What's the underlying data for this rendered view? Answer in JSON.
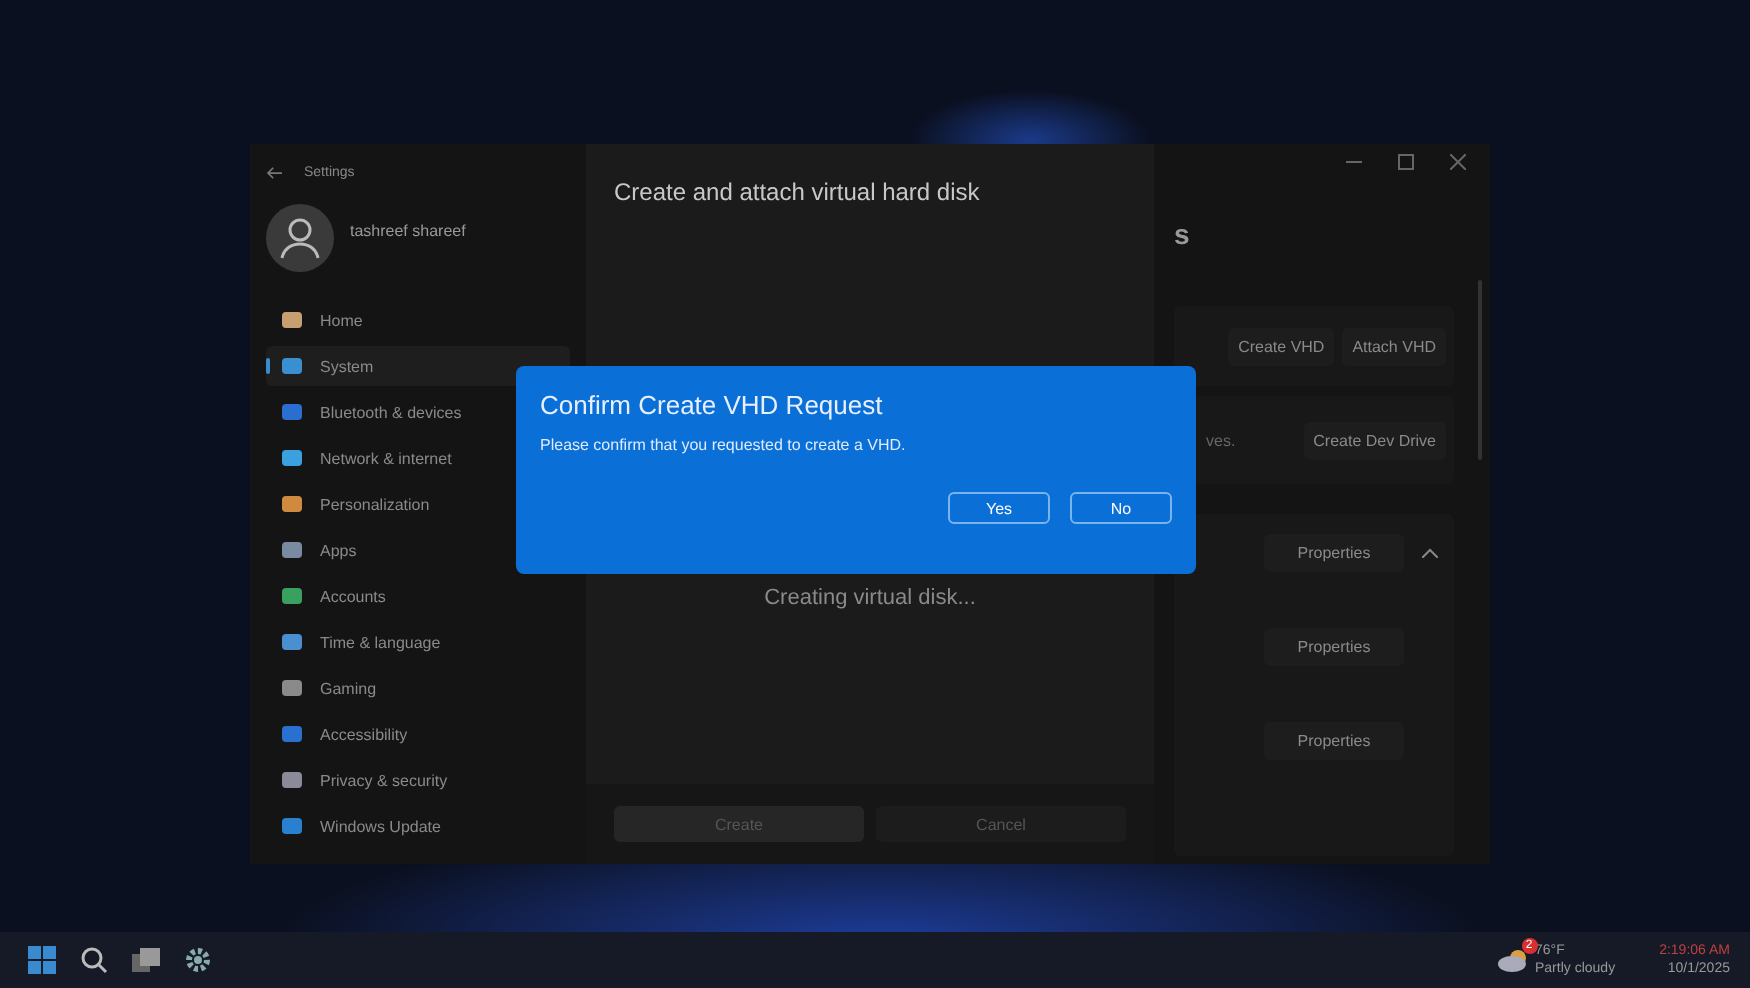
{
  "window": {
    "title": "Settings"
  },
  "user": {
    "name": "tashreef shareef"
  },
  "nav": [
    {
      "label": "Home",
      "selected": false
    },
    {
      "label": "System",
      "selected": true
    },
    {
      "label": "Bluetooth & devices",
      "selected": false
    },
    {
      "label": "Network & internet",
      "selected": false
    },
    {
      "label": "Personalization",
      "selected": false
    },
    {
      "label": "Apps",
      "selected": false
    },
    {
      "label": "Accounts",
      "selected": false
    },
    {
      "label": "Time & language",
      "selected": false
    },
    {
      "label": "Gaming",
      "selected": false
    },
    {
      "label": "Accessibility",
      "selected": false
    },
    {
      "label": "Privacy & security",
      "selected": false
    },
    {
      "label": "Windows Update",
      "selected": false
    }
  ],
  "page": {
    "title": "s",
    "actions": [
      "Create VHD",
      "Attach VHD"
    ],
    "dev_drive": {
      "text": "ves.",
      "button": "Create Dev Drive"
    },
    "volumes": {
      "expanded": true,
      "buttons": [
        "Properties",
        "Properties",
        "Properties"
      ]
    }
  },
  "dialog": {
    "title": "Create and attach virtual hard disk",
    "status": "Creating virtual disk...",
    "buttons": [
      "Create",
      "Cancel"
    ]
  },
  "confirm": {
    "title": "Confirm Create VHD Request",
    "message": "Please confirm that you requested to create a VHD.",
    "buttons": [
      "Yes",
      "No"
    ]
  },
  "taskbar": {
    "weather": {
      "badge": "2",
      "temperature": "76°F",
      "condition": "Partly cloudy"
    },
    "time": "2:19:06 AM",
    "date": "10/1/2025"
  }
}
